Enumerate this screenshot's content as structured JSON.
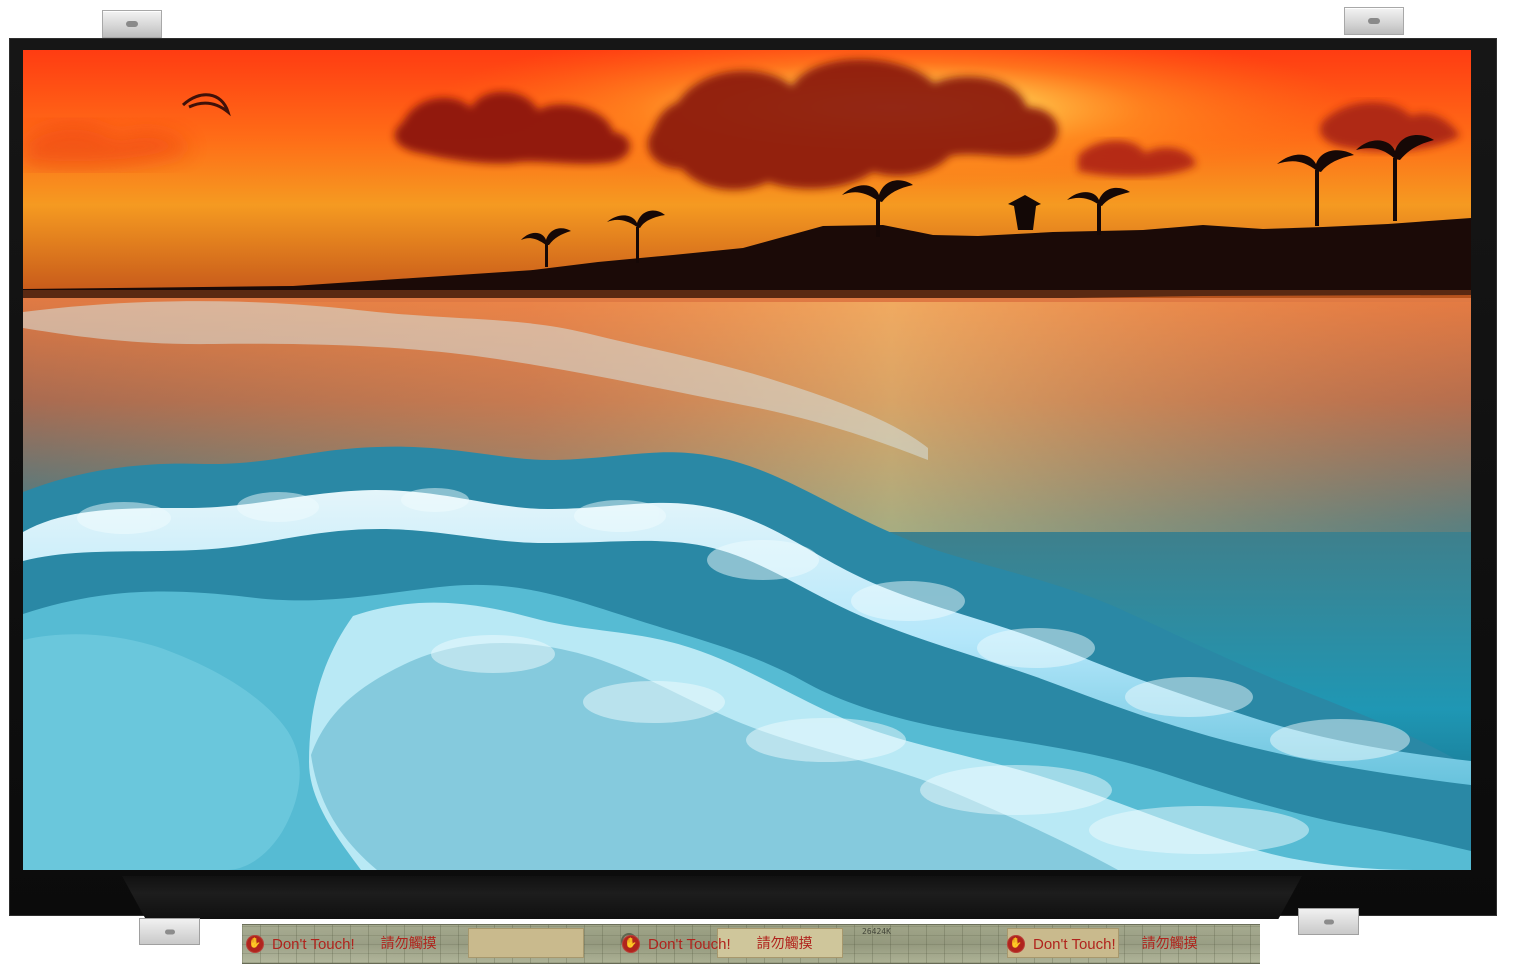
{
  "title": "",
  "photo": {
    "subject": "",
    "sky_color": "#ff5a12",
    "sun_color": "#ffd65a",
    "sea_color": "#2ca6c0",
    "foam_color": "#e9f7ff"
  },
  "panel": {
    "bezel_color": "#111111",
    "pcb_color": "#95997d"
  },
  "warnings": [
    {
      "text": "Don't Touch!",
      "text_cn": "請勿觸摸"
    },
    {
      "text": "Don't Touch!",
      "text_cn": "請勿觸摸"
    },
    {
      "text": "Don't Touch!",
      "text_cn": "請勿觸摸"
    }
  ],
  "pcb_label": "26424K"
}
